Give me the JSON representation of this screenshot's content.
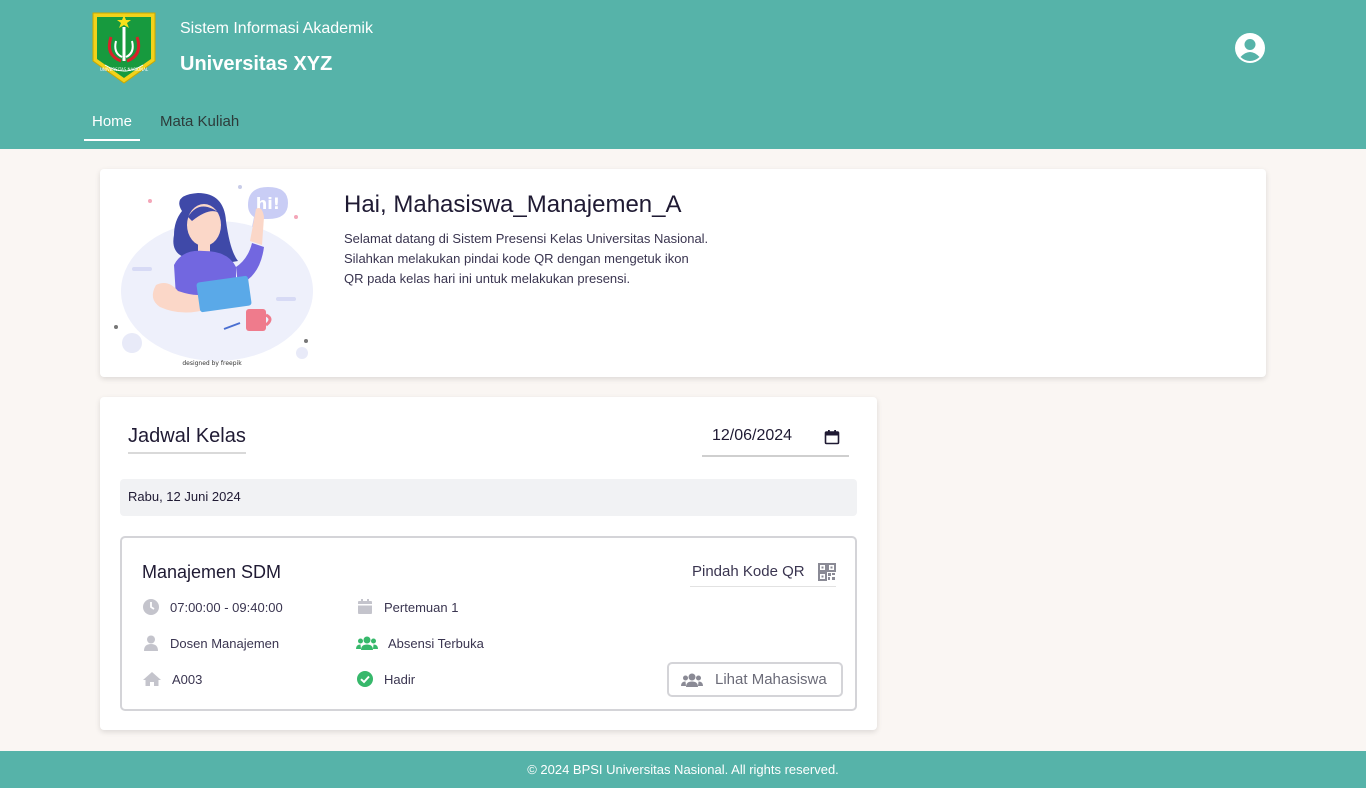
{
  "header": {
    "subtitle": "Sistem Informasi Akademik",
    "title": "Universitas XYZ",
    "logo_text": "UNIVERSITAS NASIONAL",
    "color": "#56b3a9"
  },
  "nav": {
    "items": [
      {
        "label": "Home",
        "active": true
      },
      {
        "label": "Mata Kuliah",
        "active": false
      }
    ]
  },
  "welcome": {
    "greeting": "Hai, Mahasiswa_Manajemen_A",
    "lines": [
      "Selamat datang di Sistem Presensi Kelas Universitas Nasional.",
      "Silahkan melakukan pindai kode QR dengan mengetuk ikon",
      "QR pada kelas hari ini untuk melakukan presensi."
    ],
    "illustration_bubble": "hi!",
    "illustration_credit": "designed by freepik"
  },
  "schedule": {
    "title": "Jadwal Kelas",
    "date_value": "12/06/2024",
    "day_label": "Rabu, 12 Juni 2024",
    "class": {
      "name": "Manajemen SDM",
      "qr_label": "Pindah Kode QR",
      "time": "07:00:00 - 09:40:00",
      "meeting": "Pertemuan 1",
      "lecturer": "Dosen Manajemen",
      "attendance_status": "Absensi Terbuka",
      "room": "A003",
      "presence": "Hadir",
      "view_students_label": "Lihat Mahasiswa"
    }
  },
  "footer": {
    "text": "© 2024 BPSI Universitas Nasional. All rights reserved."
  }
}
